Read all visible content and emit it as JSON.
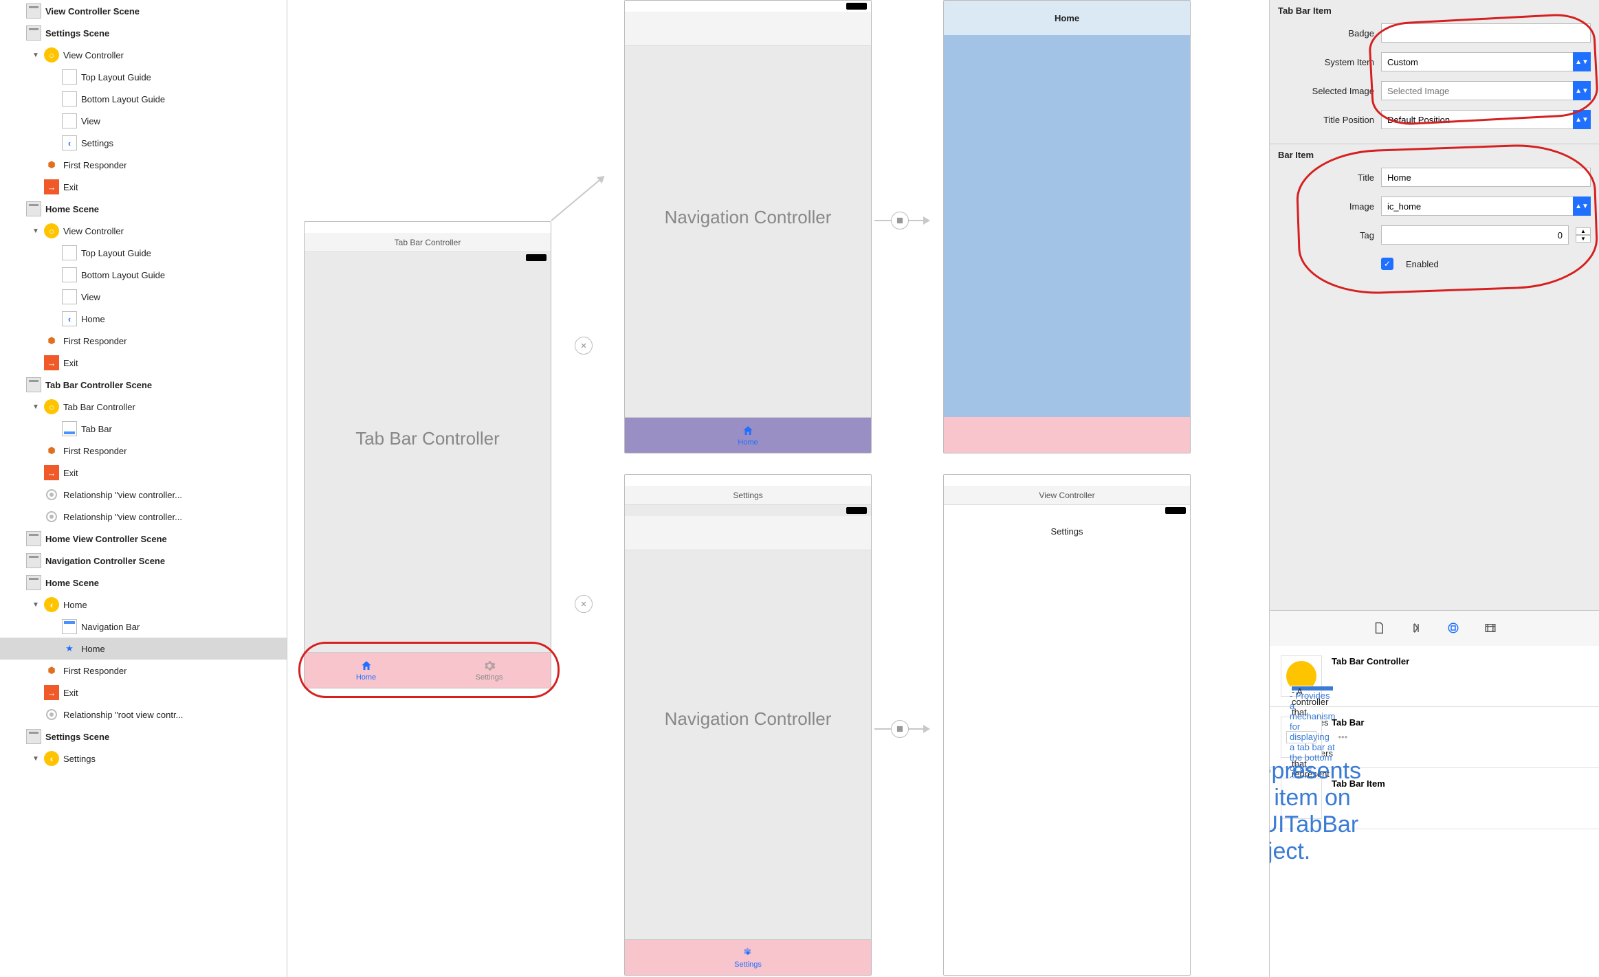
{
  "outline": [
    {
      "indent": 0,
      "icon": "scene",
      "bold": true,
      "label": "View Controller Scene"
    },
    {
      "indent": 0,
      "icon": "scene",
      "bold": true,
      "label": "Settings Scene"
    },
    {
      "indent": 1,
      "tri": "▼",
      "icon": "vc",
      "label": "View Controller"
    },
    {
      "indent": 2,
      "icon": "box",
      "label": "Top Layout Guide"
    },
    {
      "indent": 2,
      "icon": "box",
      "label": "Bottom Layout Guide"
    },
    {
      "indent": 2,
      "icon": "box",
      "label": "View"
    },
    {
      "indent": 2,
      "icon": "back",
      "label": "Settings"
    },
    {
      "indent": 1,
      "icon": "cube",
      "label": "First Responder"
    },
    {
      "indent": 1,
      "icon": "exit",
      "label": "Exit"
    },
    {
      "indent": 0,
      "icon": "scene",
      "bold": true,
      "label": "Home Scene"
    },
    {
      "indent": 1,
      "tri": "▼",
      "icon": "vc",
      "label": "View Controller"
    },
    {
      "indent": 2,
      "icon": "box",
      "label": "Top Layout Guide"
    },
    {
      "indent": 2,
      "icon": "box",
      "label": "Bottom Layout Guide"
    },
    {
      "indent": 2,
      "icon": "box",
      "label": "View"
    },
    {
      "indent": 2,
      "icon": "back",
      "label": "Home"
    },
    {
      "indent": 1,
      "icon": "cube",
      "label": "First Responder"
    },
    {
      "indent": 1,
      "icon": "exit",
      "label": "Exit"
    },
    {
      "indent": 0,
      "icon": "scene",
      "bold": true,
      "label": "Tab Bar Controller Scene"
    },
    {
      "indent": 1,
      "tri": "▼",
      "icon": "vc",
      "label": "Tab Bar Controller"
    },
    {
      "indent": 2,
      "icon": "tabbar",
      "label": "Tab Bar"
    },
    {
      "indent": 1,
      "icon": "cube",
      "label": "First Responder"
    },
    {
      "indent": 1,
      "icon": "exit",
      "label": "Exit"
    },
    {
      "indent": 1,
      "icon": "rel",
      "label": "Relationship \"view controller..."
    },
    {
      "indent": 1,
      "icon": "rel",
      "label": "Relationship \"view controller..."
    },
    {
      "indent": 0,
      "icon": "scene",
      "bold": true,
      "label": "Home View Controller Scene"
    },
    {
      "indent": 0,
      "icon": "scene",
      "bold": true,
      "label": "Navigation Controller Scene"
    },
    {
      "indent": 0,
      "icon": "scene",
      "bold": true,
      "label": "Home Scene"
    },
    {
      "indent": 1,
      "tri": "▼",
      "icon": "nav",
      "label": "Home"
    },
    {
      "indent": 2,
      "icon": "navbar",
      "label": "Navigation Bar"
    },
    {
      "indent": 2,
      "icon": "star",
      "label": "Home",
      "selected": true
    },
    {
      "indent": 1,
      "icon": "cube",
      "label": "First Responder"
    },
    {
      "indent": 1,
      "icon": "exit",
      "label": "Exit"
    },
    {
      "indent": 1,
      "icon": "rel",
      "label": "Relationship \"root view contr..."
    },
    {
      "indent": 0,
      "icon": "scene",
      "bold": true,
      "label": "Settings Scene"
    },
    {
      "indent": 1,
      "tri": "▼",
      "icon": "nav",
      "label": "Settings"
    }
  ],
  "canvas": {
    "tabBarController": {
      "title": "Tab Bar Controller",
      "centerLabel": "Tab Bar Controller",
      "tabs": [
        {
          "icon": "home",
          "label": "Home",
          "active": true
        },
        {
          "icon": "gear",
          "label": "Settings",
          "active": false
        }
      ]
    },
    "navTop": {
      "centerLabel": "Navigation Controller",
      "tabIcon": "home",
      "tabLabel": "Home"
    },
    "navBottom": {
      "title": "Settings",
      "centerLabel": "Navigation Controller",
      "tabIcon": "gear",
      "tabLabel": "Settings"
    },
    "homeVC": {
      "navTitle": "Home"
    },
    "settingsVC": {
      "title": "View Controller",
      "navTitle": "Settings"
    }
  },
  "inspector": {
    "section1": {
      "header": "Tab Bar Item",
      "badge_label": "Badge",
      "badge": "",
      "system_item_label": "System Item",
      "system_item": "Custom",
      "selected_image_label": "Selected Image",
      "selected_image_placeholder": "Selected Image",
      "title_position_label": "Title Position",
      "title_position": "Default Position"
    },
    "section2": {
      "header": "Bar Item",
      "title_label": "Title",
      "title": "Home",
      "image_label": "Image",
      "image": "ic_home",
      "tag_label": "Tag",
      "tag": "0",
      "enabled_label": "Enabled",
      "enabled": true
    }
  },
  "library": [
    {
      "title": "Tab Bar Controller",
      "desc": " - A controller that manages a set of view controllers that represent tab bar items.",
      "icon": "tbc"
    },
    {
      "title": "Tab Bar",
      "desc": " - Provides a mechanism for displaying a tab bar at the bottom of the screen.",
      "icon": "tb"
    },
    {
      "title": "Tab Bar Item",
      "desc": " - Represents an item on a UITabBar object.",
      "icon": "tbi"
    }
  ]
}
